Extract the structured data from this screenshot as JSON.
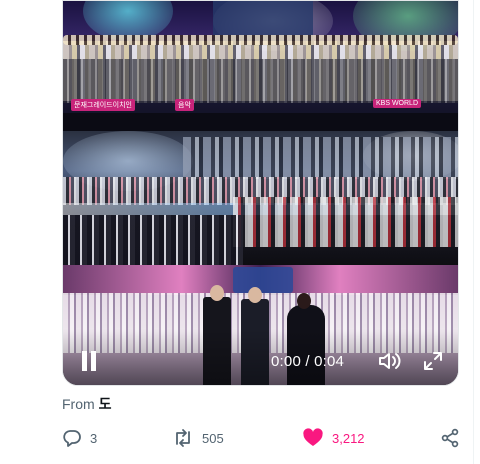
{
  "video": {
    "time_display": "0:00 / 0:04",
    "state": "paused",
    "top_captions": [
      "문재그레이드이치인",
      "음악",
      "KBS WORLD"
    ]
  },
  "source": {
    "prefix": "From",
    "name": "도"
  },
  "actions": {
    "replies": "3",
    "reposts": "505",
    "likes": "3,212"
  },
  "colors": {
    "like_pink": "#f91880",
    "muted_gray": "#536471",
    "text_dark": "#0f1419"
  }
}
